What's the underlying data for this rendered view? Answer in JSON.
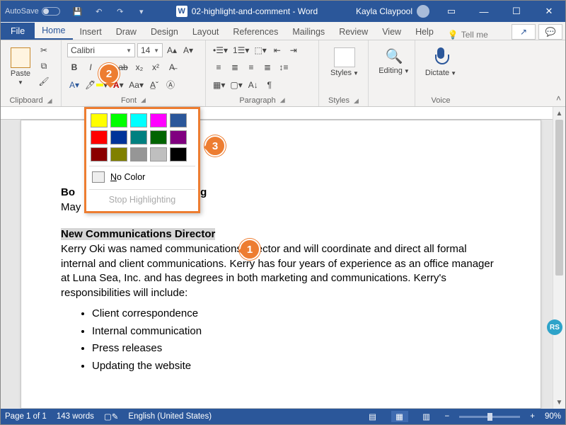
{
  "titlebar": {
    "autosave_label": "AutoSave",
    "doc_title": "02-highlight-and-comment - Word",
    "user_name": "Kayla Claypool"
  },
  "tabs": {
    "file": "File",
    "items": [
      "Home",
      "Insert",
      "Draw",
      "Design",
      "Layout",
      "References",
      "Mailings",
      "Review",
      "View",
      "Help"
    ],
    "active_index": 0,
    "tell_me": "Tell me"
  },
  "ribbon": {
    "clipboard": {
      "paste": "Paste",
      "label": "Clipboard"
    },
    "font": {
      "name": "Calibri",
      "size": "14",
      "label": "Font"
    },
    "paragraph": {
      "label": "Paragraph"
    },
    "styles": {
      "btn": "Styles",
      "label": "Styles"
    },
    "editing": {
      "btn": "Editing"
    },
    "voice": {
      "btn": "Dictate",
      "label": "Voice"
    }
  },
  "highlight_popup": {
    "colors_row1": [
      "#ffff00",
      "#00ff00",
      "#00ffff",
      "#ff00ff",
      "#2b579a"
    ],
    "colors_row2": [
      "#ff0000",
      "#003399",
      "#008080",
      "#006400",
      "#800080"
    ],
    "colors_row3": [
      "#8b0000",
      "#808000",
      "#969696",
      "#bfbfbf",
      "#000000"
    ],
    "no_color": "No Color",
    "no_color_key": "N",
    "stop": "Stop Highlighting"
  },
  "callouts": {
    "c1": "1",
    "c2": "2",
    "c3": "3"
  },
  "document": {
    "heading1_a": "Bo",
    "heading1_b": "ng",
    "date": "May 6",
    "subhead": "New Communications Director",
    "body": "Kerry Oki was named communications director and will coordinate and direct all formal internal and client communications. Kerry has four years of experience as an office manager at Luna Sea, Inc. and has degrees in both marketing and communications. Kerry's responsibilities will include:",
    "bullets": [
      "Client correspondence",
      "Internal communication",
      "Press releases",
      "Updating the website"
    ]
  },
  "status": {
    "page": "Page 1 of 1",
    "words": "143 words",
    "lang": "English (United States)",
    "zoom": "90%"
  },
  "presence_initials": "RS"
}
